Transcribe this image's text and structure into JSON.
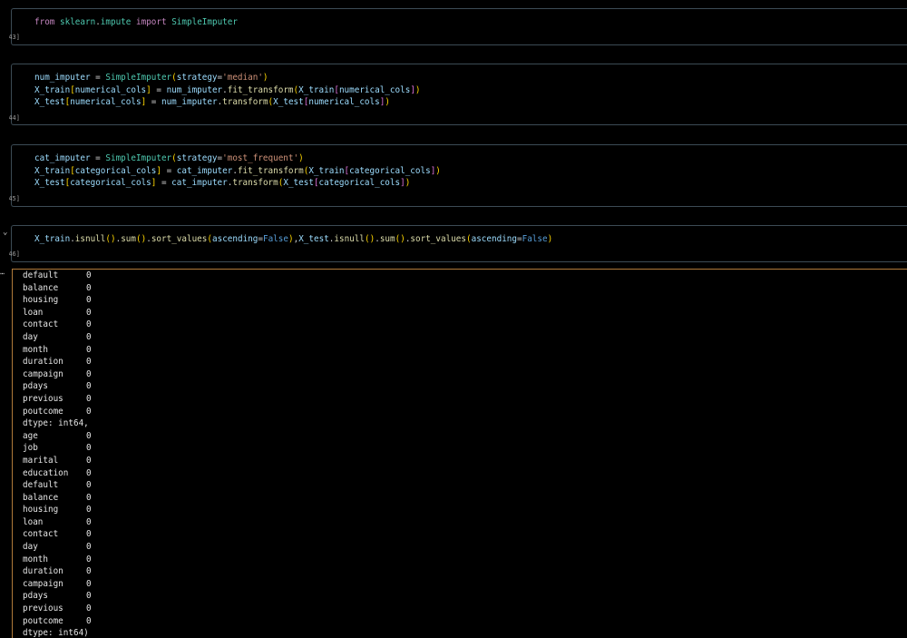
{
  "cells": [
    {
      "label": "[43]",
      "lines": [
        [
          [
            "kw",
            "from"
          ],
          [
            "plain",
            " "
          ],
          [
            "mod",
            "sklearn"
          ],
          [
            "plain",
            "."
          ],
          [
            "mod",
            "impute"
          ],
          [
            "plain",
            " "
          ],
          [
            "kw",
            "import"
          ],
          [
            "plain",
            " "
          ],
          [
            "cls",
            "SimpleImputer"
          ]
        ]
      ]
    },
    {
      "label": "[44]",
      "lines": [
        [
          [
            "var",
            "num_imputer"
          ],
          [
            "plain",
            " = "
          ],
          [
            "cls",
            "SimpleImputer"
          ],
          [
            "br1",
            "("
          ],
          [
            "var",
            "strategy"
          ],
          [
            "plain",
            "="
          ],
          [
            "str",
            "'median'"
          ],
          [
            "br1",
            ")"
          ]
        ],
        [
          [
            "var",
            "X_train"
          ],
          [
            "br1",
            "["
          ],
          [
            "var",
            "numerical_cols"
          ],
          [
            "br1",
            "]"
          ],
          [
            "plain",
            " = "
          ],
          [
            "var",
            "num_imputer"
          ],
          [
            "plain",
            "."
          ],
          [
            "fn",
            "fit_transform"
          ],
          [
            "br1",
            "("
          ],
          [
            "var",
            "X_train"
          ],
          [
            "br2",
            "["
          ],
          [
            "var",
            "numerical_cols"
          ],
          [
            "br2",
            "]"
          ],
          [
            "br1",
            ")"
          ]
        ],
        [
          [
            "var",
            "X_test"
          ],
          [
            "br1",
            "["
          ],
          [
            "var",
            "numerical_cols"
          ],
          [
            "br1",
            "]"
          ],
          [
            "plain",
            " = "
          ],
          [
            "var",
            "num_imputer"
          ],
          [
            "plain",
            "."
          ],
          [
            "fn",
            "transform"
          ],
          [
            "br1",
            "("
          ],
          [
            "var",
            "X_test"
          ],
          [
            "br2",
            "["
          ],
          [
            "var",
            "numerical_cols"
          ],
          [
            "br2",
            "]"
          ],
          [
            "br1",
            ")"
          ]
        ]
      ]
    },
    {
      "label": "[45]",
      "lines": [
        [
          [
            "var",
            "cat_imputer"
          ],
          [
            "plain",
            " = "
          ],
          [
            "cls",
            "SimpleImputer"
          ],
          [
            "br1",
            "("
          ],
          [
            "var",
            "strategy"
          ],
          [
            "plain",
            "="
          ],
          [
            "str",
            "'most_frequent'"
          ],
          [
            "br1",
            ")"
          ]
        ],
        [
          [
            "var",
            "X_train"
          ],
          [
            "br1",
            "["
          ],
          [
            "var",
            "categorical_cols"
          ],
          [
            "br1",
            "]"
          ],
          [
            "plain",
            " = "
          ],
          [
            "var",
            "cat_imputer"
          ],
          [
            "plain",
            "."
          ],
          [
            "fn",
            "fit_transform"
          ],
          [
            "br1",
            "("
          ],
          [
            "var",
            "X_train"
          ],
          [
            "br2",
            "["
          ],
          [
            "var",
            "categorical_cols"
          ],
          [
            "br2",
            "]"
          ],
          [
            "br1",
            ")"
          ]
        ],
        [
          [
            "var",
            "X_test"
          ],
          [
            "br1",
            "["
          ],
          [
            "var",
            "categorical_cols"
          ],
          [
            "br1",
            "]"
          ],
          [
            "plain",
            " = "
          ],
          [
            "var",
            "cat_imputer"
          ],
          [
            "plain",
            "."
          ],
          [
            "fn",
            "transform"
          ],
          [
            "br1",
            "("
          ],
          [
            "var",
            "X_test"
          ],
          [
            "br2",
            "["
          ],
          [
            "var",
            "categorical_cols"
          ],
          [
            "br2",
            "]"
          ],
          [
            "br1",
            ")"
          ]
        ]
      ]
    },
    {
      "label": "[46]",
      "lines": [
        [
          [
            "var",
            "X_train"
          ],
          [
            "plain",
            "."
          ],
          [
            "fn",
            "isnull"
          ],
          [
            "br1",
            "()"
          ],
          [
            "plain",
            "."
          ],
          [
            "fn",
            "sum"
          ],
          [
            "br1",
            "()"
          ],
          [
            "plain",
            "."
          ],
          [
            "fn",
            "sort_values"
          ],
          [
            "br1",
            "("
          ],
          [
            "var",
            "ascending"
          ],
          [
            "plain",
            "="
          ],
          [
            "const",
            "False"
          ],
          [
            "br1",
            ")"
          ],
          [
            "plain",
            ","
          ],
          [
            "var",
            "X_test"
          ],
          [
            "plain",
            "."
          ],
          [
            "fn",
            "isnull"
          ],
          [
            "br1",
            "()"
          ],
          [
            "plain",
            "."
          ],
          [
            "fn",
            "sum"
          ],
          [
            "br1",
            "()"
          ],
          [
            "plain",
            "."
          ],
          [
            "fn",
            "sort_values"
          ],
          [
            "br1",
            "("
          ],
          [
            "var",
            "ascending"
          ],
          [
            "plain",
            "="
          ],
          [
            "const",
            "False"
          ],
          [
            "br1",
            ")"
          ]
        ]
      ]
    }
  ],
  "output_rows": [
    [
      "default",
      "0"
    ],
    [
      "balance",
      "0"
    ],
    [
      "housing",
      "0"
    ],
    [
      "loan",
      "0"
    ],
    [
      "contact",
      "0"
    ],
    [
      "day",
      "0"
    ],
    [
      "month",
      "0"
    ],
    [
      "duration",
      "0"
    ],
    [
      "campaign",
      "0"
    ],
    [
      "pdays",
      "0"
    ],
    [
      "previous",
      "0"
    ],
    [
      "poutcome",
      "0"
    ],
    [
      "dtype: int64,",
      ""
    ],
    [
      "age",
      "0"
    ],
    [
      "job",
      "0"
    ],
    [
      "marital",
      "0"
    ],
    [
      "education",
      "0"
    ],
    [
      "default",
      "0"
    ],
    [
      "balance",
      "0"
    ],
    [
      "housing",
      "0"
    ],
    [
      "loan",
      "0"
    ],
    [
      "contact",
      "0"
    ],
    [
      "day",
      "0"
    ],
    [
      "month",
      "0"
    ],
    [
      "duration",
      "0"
    ],
    [
      "campaign",
      "0"
    ],
    [
      "pdays",
      "0"
    ],
    [
      "previous",
      "0"
    ],
    [
      "poutcome",
      "0"
    ],
    [
      "dtype: int64)",
      ""
    ]
  ]
}
